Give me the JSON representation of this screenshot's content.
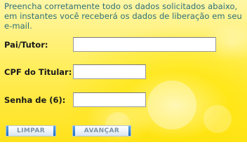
{
  "intro_text": "Preencha corretamente todo os dados solicitados abaixo, em instantes você receberá os dados de liberação em seu e-mail.",
  "form": {
    "guardian": {
      "label": "Pai/Tutor:",
      "value": "",
      "placeholder": ""
    },
    "cpf": {
      "label": "CPF do Titular:",
      "value": "",
      "placeholder": ""
    },
    "password": {
      "label": "Senha de (6):",
      "value": "",
      "placeholder": ""
    }
  },
  "buttons": {
    "clear_label": "LIMPAR",
    "next_label": "AVANÇAR"
  },
  "colors": {
    "intro_text": "#2b6f7a",
    "button_cap": "#1f6fbf",
    "button_text": "#7c93a8",
    "background": "#ffe21a"
  }
}
